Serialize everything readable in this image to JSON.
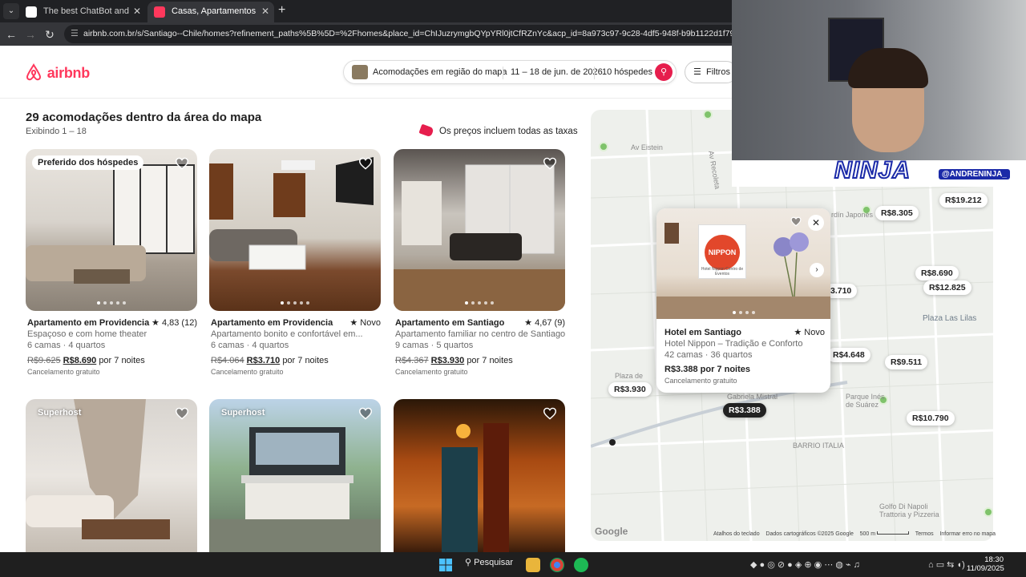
{
  "browser": {
    "tabs": [
      {
        "label": "The best ChatBot and Widgets",
        "favicon_color": "#ffffff",
        "active": false
      },
      {
        "label": "Casas, Apartamentos e Aluguéis",
        "favicon_color": "#ff385c",
        "active": true
      }
    ],
    "url": "airbnb.com.br/s/Santiago--Chile/homes?refinement_paths%5B%5D=%2Fhomes&place_id=ChIJuzrymgbQYpYRl0jtCfRZnYc&acp_id=8a973c97-9c28-4df5-948f-b9b1122d1f79&date_picker_type=calendar"
  },
  "header": {
    "logo": "airbnb",
    "search": {
      "location": "Acomodações em região do mapa",
      "dates": "11 – 18 de jun. de 2026",
      "guests": "10 hóspedes"
    },
    "filters_label": "Filtros"
  },
  "results": {
    "title": "29 acomodações dentro da área do mapa",
    "subtitle": "Exibindo 1 – 18",
    "taxes_note": "Os preços incluem todas as taxas"
  },
  "listings": [
    {
      "badge": "Preferido dos hóspedes",
      "title": "Apartamento em Providencia",
      "rating": "★ 4,83 (12)",
      "desc": "Espaçoso e com home theater",
      "rooms": "6 camas · 4 quartos",
      "old_price": "R$9.625",
      "price": "R$8.690",
      "per": "por 7 noites",
      "free": "Cancelamento gratuito"
    },
    {
      "badge": "",
      "title": "Apartamento em Providencia",
      "rating": "★ Novo",
      "desc": "Apartamento bonito e confortável em...",
      "rooms": "6 camas · 4 quartos",
      "old_price": "R$4.064",
      "price": "R$3.710",
      "per": "por 7 noites",
      "free": "Cancelamento gratuito"
    },
    {
      "badge": "",
      "title": "Apartamento em Santiago",
      "rating": "★ 4,67 (9)",
      "desc": "Apartamento familiar no centro de Santiago",
      "rooms": "9 camas · 5 quartos",
      "old_price": "R$4.367",
      "price": "R$3.930",
      "per": "por 7 noites",
      "free": "Cancelamento gratuito"
    },
    {
      "badge": "Superhost"
    },
    {
      "badge": "Superhost"
    },
    {
      "badge": ""
    }
  ],
  "map": {
    "pins": [
      "R$19.212",
      "R$8.305",
      "R$8.690",
      "R$12.825",
      "3.710",
      "R$4.648",
      "R$9.511",
      "R$3.930",
      "R$3.388",
      "R$10.790"
    ],
    "labels": [
      "Av Eistein",
      "Av Recoleta",
      "Plaza Las Lilas",
      "Parque Inés de Suárez",
      "BARRIO ITALIA",
      "Plaza de",
      "Gabriela Mistral",
      "Golfo Di Napoli Trattoria y Pizzeria",
      "rdín Japonés"
    ],
    "popup": {
      "title": "Hotel em Santiago",
      "rating": "★ Novo",
      "desc": "Hotel Nippon – Tradição e Conforto",
      "rooms": "42 camas · 36 quartos",
      "price": "R$3.388 por 7 noites",
      "free": "Cancelamento gratuito",
      "sign_text": "NIPPON",
      "sign_caption": "Hotel Nippon Centro de Eventos"
    },
    "footer": [
      "Atalhos do teclado",
      "Dados cartográficos ©2025 Google",
      "500 m",
      "Termos",
      "Informar erro no mapa"
    ],
    "google": "Google"
  },
  "webcam": {
    "overlay_text": "NINJA",
    "handle": "@ANDRENINJA_"
  },
  "taskbar": {
    "search_label": "Pesquisar",
    "time": "18:30",
    "date": "11/09/2025"
  }
}
